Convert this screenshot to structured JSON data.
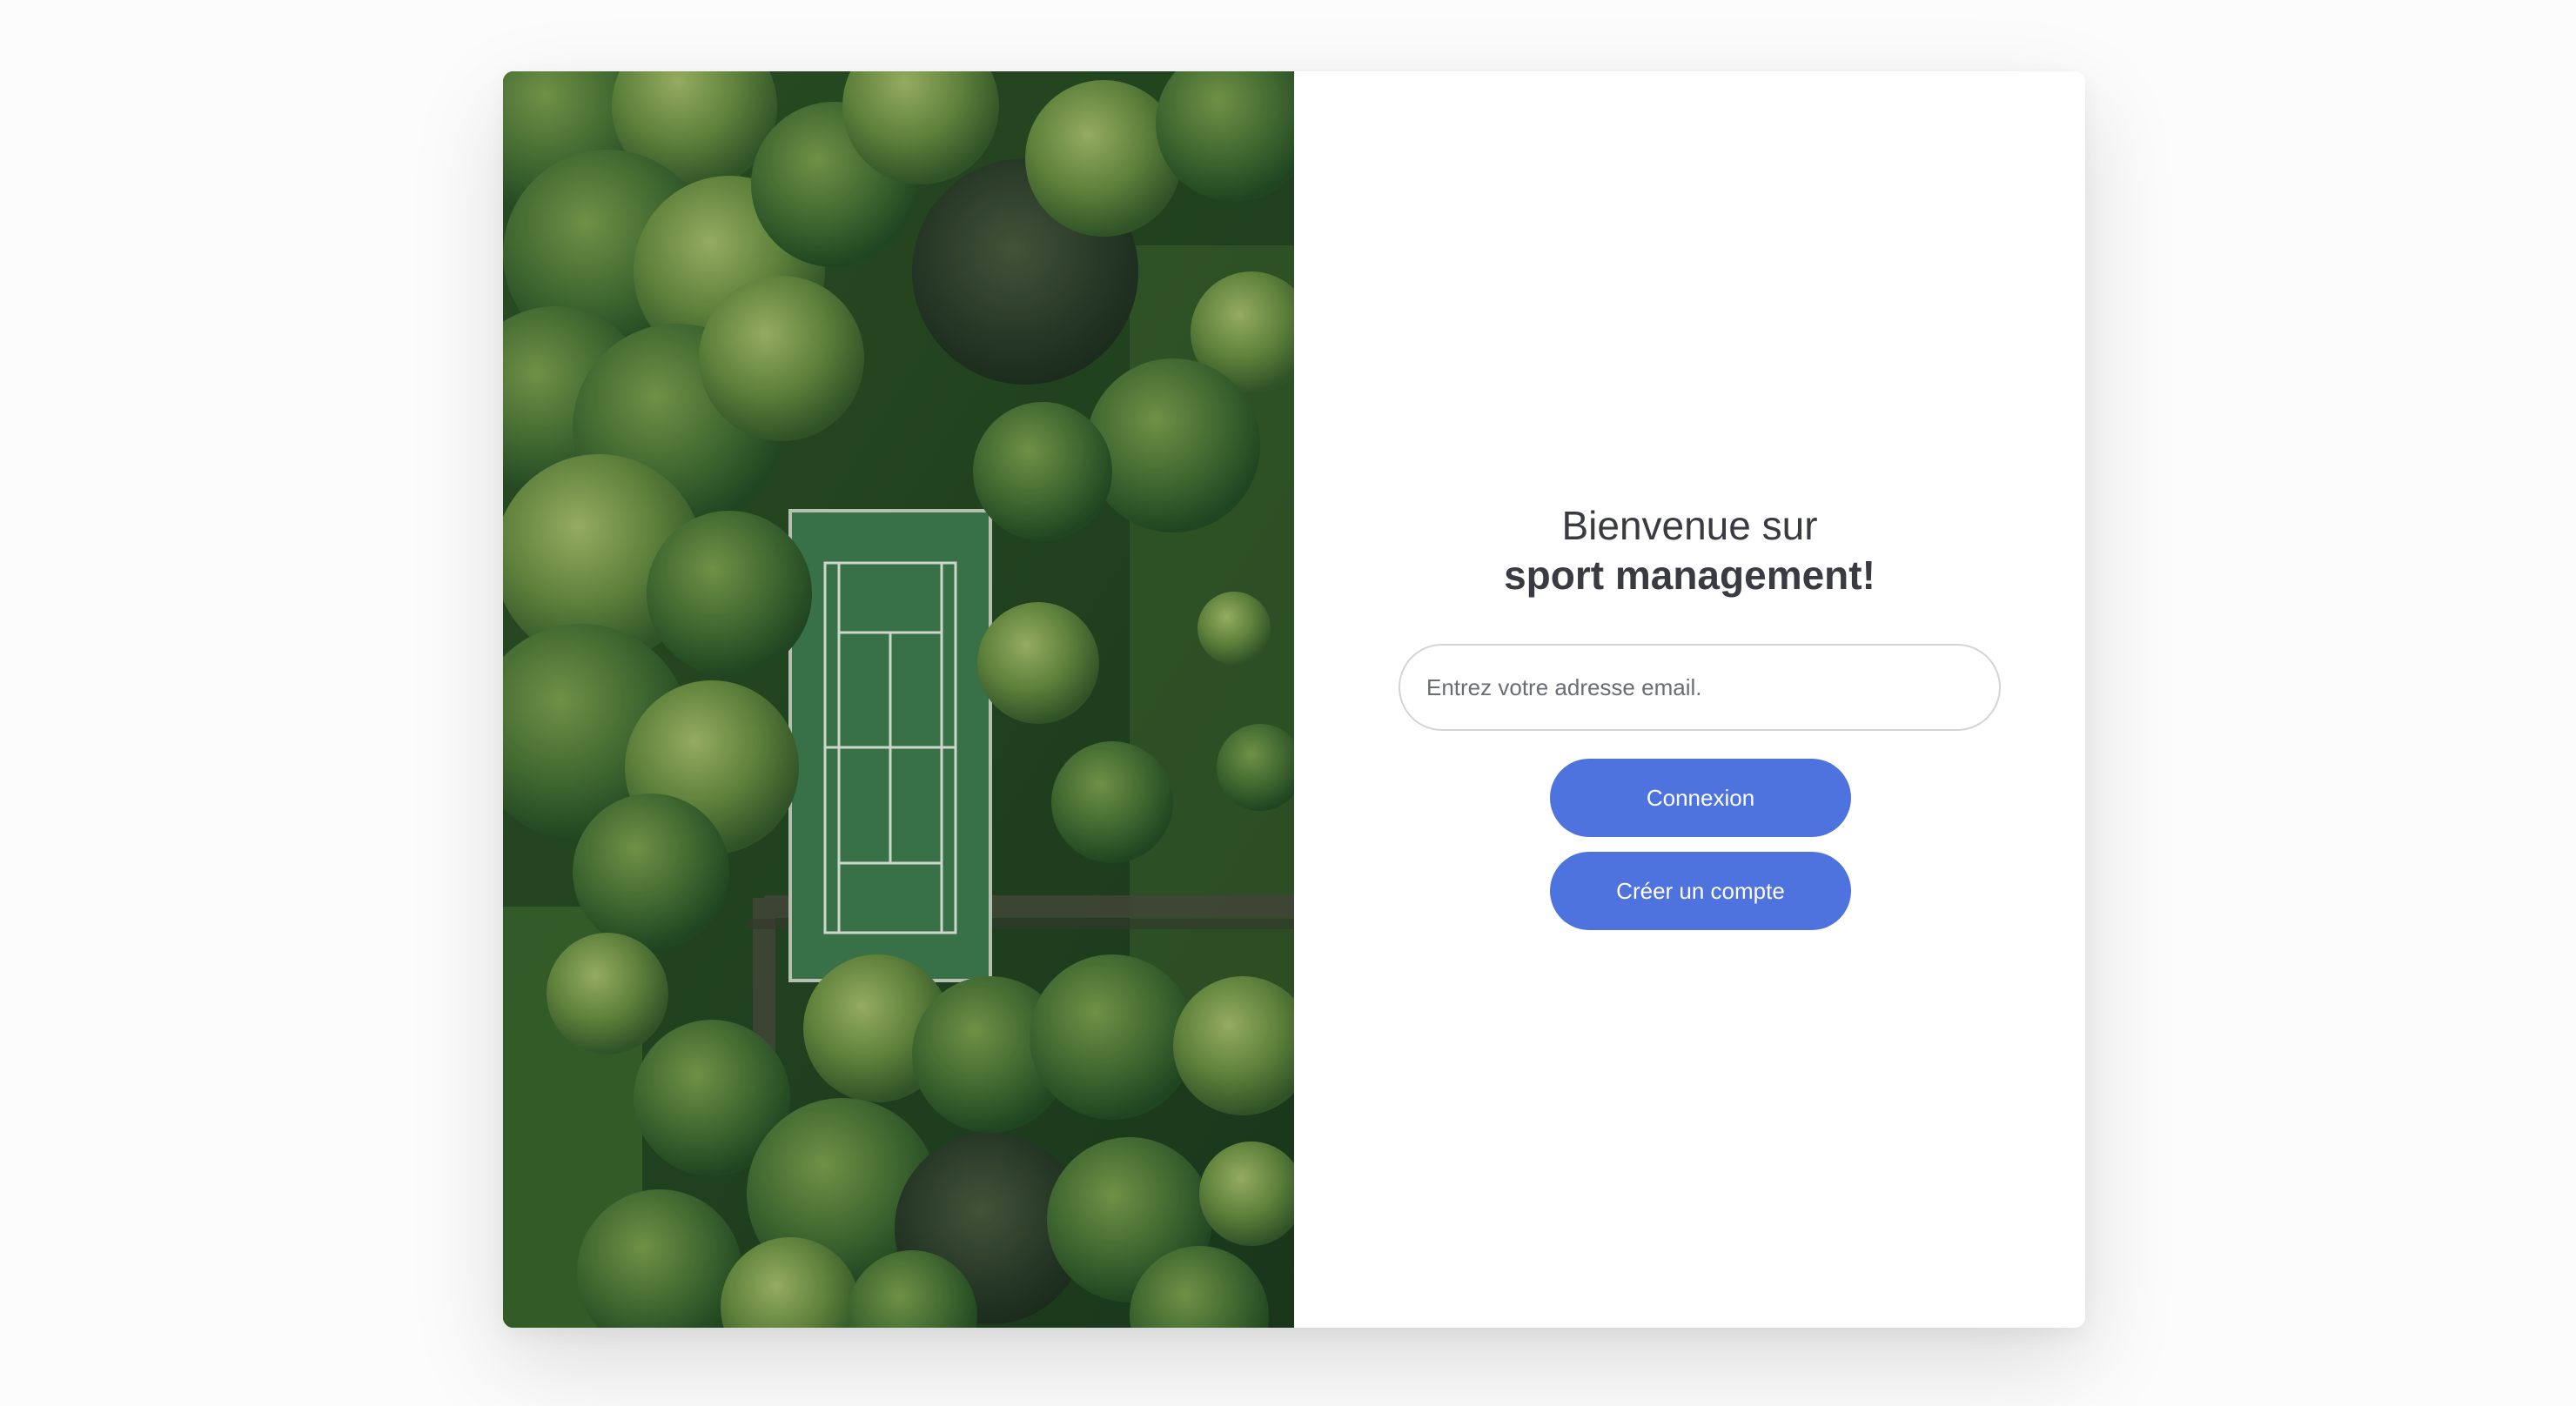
{
  "welcome": {
    "line1": "Bienvenue sur",
    "brand": "sport management",
    "punct": "!"
  },
  "form": {
    "email_placeholder": "Entrez votre adresse email.",
    "email_value": "",
    "login_label": "Connexion",
    "signup_label": "Créer un compte"
  },
  "image": {
    "subject": "aerial-view-tennis-court-among-trees"
  },
  "colors": {
    "accent": "#4e73df",
    "heading": "#3a3b42",
    "page_bg": "#fcfcfc",
    "card_bg": "#ffffff",
    "input_border": "#d4d4d8"
  }
}
